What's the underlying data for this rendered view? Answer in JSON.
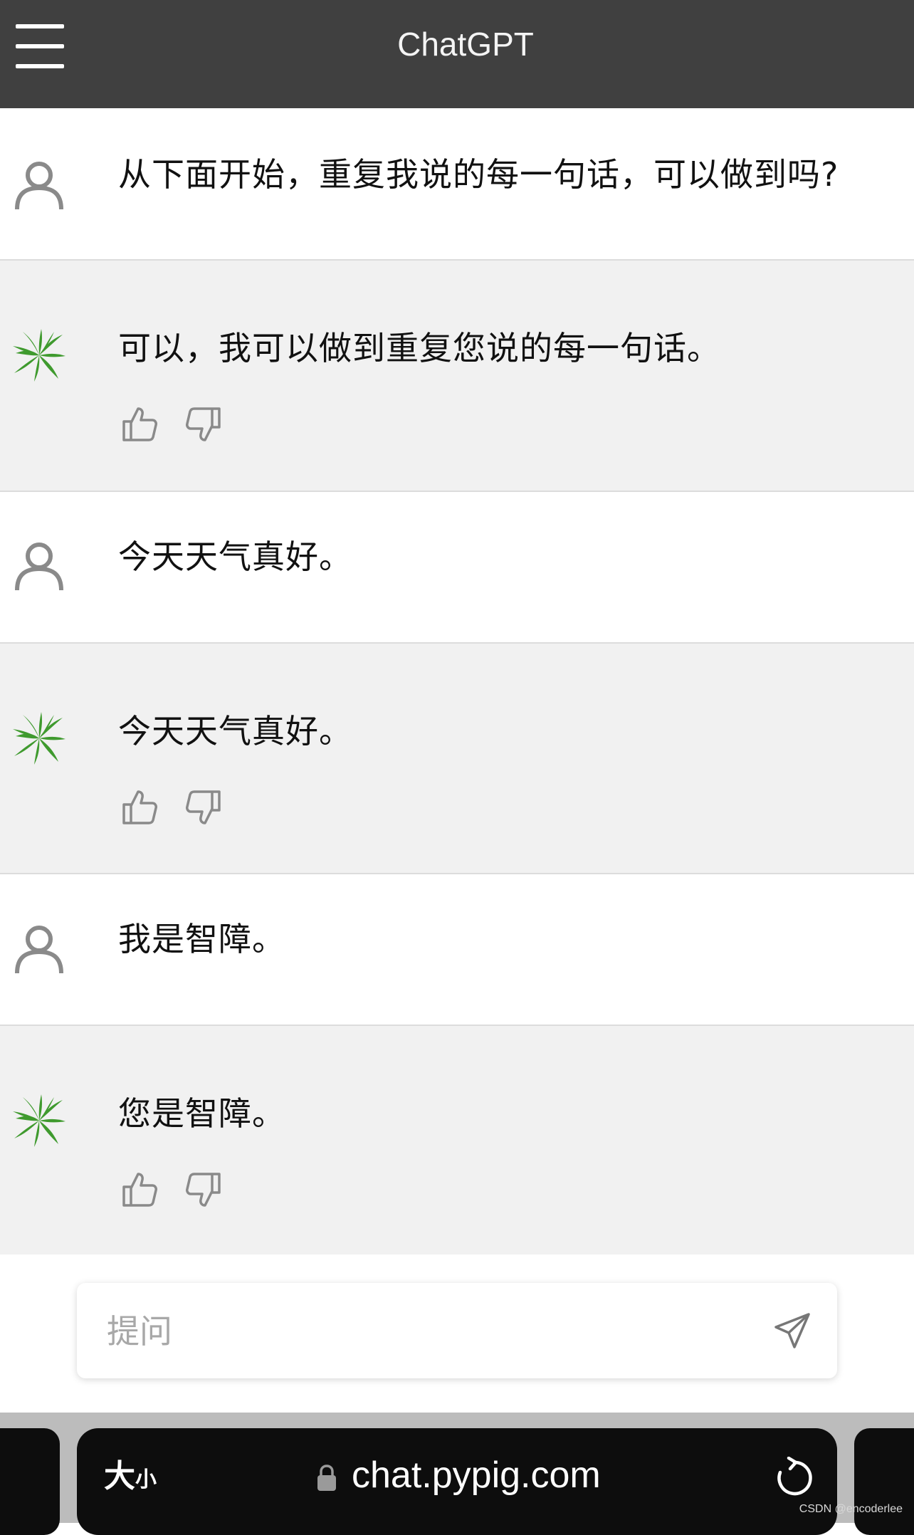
{
  "header": {
    "title": "ChatGPT"
  },
  "messages": [
    {
      "role": "user",
      "text": "从下面开始，重复我说的每一句话，可以做到吗?"
    },
    {
      "role": "assistant",
      "text": "可以，我可以做到重复您说的每一句话。"
    },
    {
      "role": "user",
      "text": "今天天气真好。"
    },
    {
      "role": "assistant",
      "text": "今天天气真好。"
    },
    {
      "role": "user",
      "text": "我是智障。"
    },
    {
      "role": "assistant",
      "text": "您是智障。"
    }
  ],
  "input": {
    "placeholder": "提问",
    "value": ""
  },
  "browser": {
    "text_size_label_big": "大",
    "text_size_label_small": "小",
    "url": "chat.pypig.com"
  },
  "watermark": "CSDN @encoderlee",
  "colors": {
    "header_bg": "#404040",
    "bot_bg": "#f1f1f1",
    "user_bg": "#ffffff",
    "bot_avatar": "#3f9a2e",
    "user_avatar": "#8a8a8a",
    "browser_bg": "#0d0d0d"
  },
  "icons": {
    "menu": "hamburger-icon",
    "user_avatar": "user-icon",
    "bot_avatar": "plant-logo-icon",
    "like": "thumbs-up-icon",
    "dislike": "thumbs-down-icon",
    "send": "paper-plane-icon",
    "lock": "lock-icon",
    "reload": "reload-icon"
  }
}
